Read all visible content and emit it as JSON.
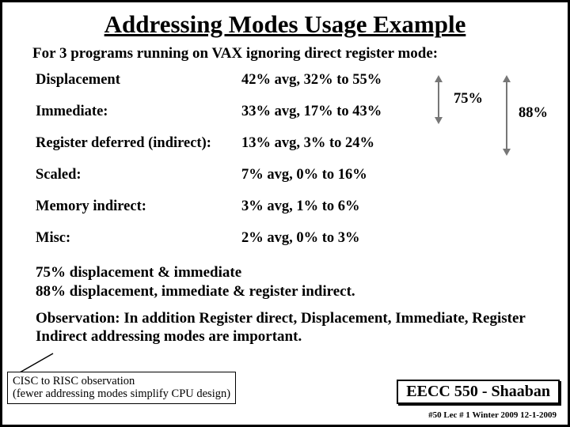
{
  "title": "Addressing Modes Usage Example",
  "subtitle": "For 3 programs running on VAX ignoring direct register mode:",
  "rows": [
    {
      "mode": "Displacement",
      "value": "42% avg, 32% to 55%"
    },
    {
      "mode": "Immediate:",
      "value": "33% avg, 17% to 43%"
    },
    {
      "mode": "Register deferred (indirect):",
      "value": "13% avg, 3% to 24%"
    },
    {
      "mode": "Scaled:",
      "value": "7% avg, 0% to 16%"
    },
    {
      "mode": "Memory indirect:",
      "value": "3% avg, 1% to 6%"
    },
    {
      "mode": "Misc:",
      "value": "2% avg, 0% to 3%"
    }
  ],
  "annot": {
    "p75": "75%",
    "p88": "88%"
  },
  "notes": {
    "line1": "75% displacement & immediate",
    "line2": "88% displacement, immediate & register indirect."
  },
  "observation": "Observation:  In addition Register direct, Displacement, Immediate, Register Indirect addressing modes are important.",
  "cisc": {
    "line1": "CISC to RISC observation",
    "line2": "(fewer addressing modes simplify CPU design)"
  },
  "course": "EECC 550 - Shaaban",
  "footer": "#50   Lec # 1  Winter 2009  12-1-2009"
}
